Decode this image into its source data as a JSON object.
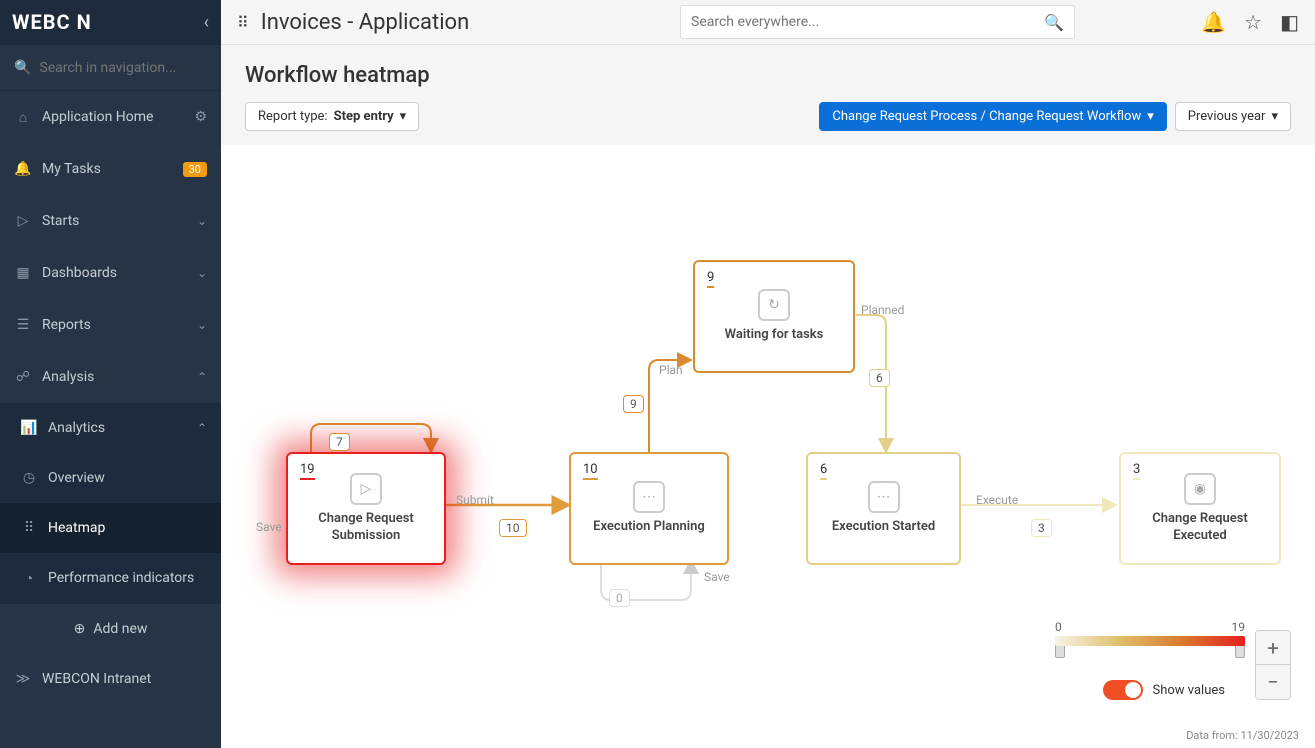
{
  "logo": "WEBC   N",
  "app_title": "Invoices - Application",
  "search_placeholder": "Search everywhere...",
  "side_search_placeholder": "Search in navigation...",
  "nav": {
    "home": "Application Home",
    "tasks": "My Tasks",
    "tasks_badge": "30",
    "starts": "Starts",
    "dashboards": "Dashboards",
    "reports": "Reports",
    "analysis": "Analysis",
    "analytics": "Analytics",
    "overview": "Overview",
    "heatmap": "Heatmap",
    "perf": "Performance indicators",
    "add_new": "Add new",
    "intranet": "WEBCON Intranet"
  },
  "page": {
    "title": "Workflow heatmap",
    "report_type_prefix": "Report type: ",
    "report_type": "Step entry",
    "process_selector": "Change Request Process / Change Request Workflow",
    "period": "Previous year",
    "data_from": "Data from: 11/30/2023",
    "show_values": "Show values",
    "legend_min": "0",
    "legend_max": "19"
  },
  "workflow": {
    "boxes": {
      "submission": {
        "count": "19",
        "label": "Change Request Submission",
        "color": "#e62020",
        "underline": "#e62020"
      },
      "planning": {
        "count": "10",
        "label": "Execution Planning",
        "color": "#e09a3a",
        "underline": "#e09a3a"
      },
      "waiting": {
        "count": "9",
        "label": "Waiting for tasks",
        "color": "#d98c2e",
        "underline": "#d98c2e"
      },
      "started": {
        "count": "6",
        "label": "Execution Started",
        "color": "#e3cf87",
        "underline": "#e3cf87"
      },
      "executed": {
        "count": "3",
        "label": "Change Request Executed",
        "color": "#efe8bc",
        "underline": "#efe8bc"
      }
    },
    "edges": {
      "save_top": {
        "label": "Save",
        "badge": "7",
        "color": "#d98c2e"
      },
      "submit": {
        "label": "Submit",
        "badge": "10",
        "color": "#e09a3a"
      },
      "plan": {
        "label": "Plan",
        "badge": "9",
        "color": "#d98c2e"
      },
      "planned": {
        "label": "Planned",
        "badge": "6",
        "color": "#e3cf87"
      },
      "execute": {
        "label": "Execute",
        "badge": "3",
        "color": "#efe8bc"
      },
      "save_bottom": {
        "label": "Save",
        "badge": "0",
        "color": "#ddd"
      }
    }
  }
}
